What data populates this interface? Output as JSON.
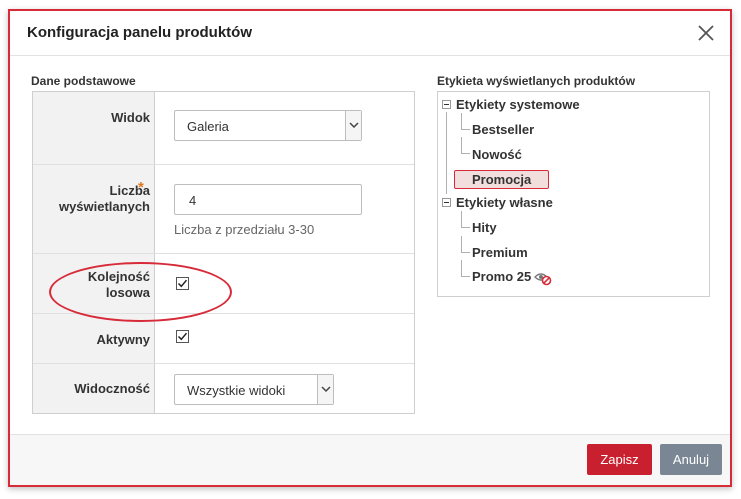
{
  "dialog": {
    "title": "Konfiguracja panelu produktów",
    "close_icon": "close-icon"
  },
  "basic": {
    "section_label": "Dane podstawowe",
    "view": {
      "label": "Widok",
      "value": "Galeria"
    },
    "count": {
      "label_line1": "Liczba",
      "label_line2": "wyświetlanych",
      "required_mark": "*",
      "value": "4",
      "hint": "Liczba z przedziału 3-30"
    },
    "random": {
      "label_line1": "Kolejność",
      "label_line2": "losowa",
      "checked": true
    },
    "active": {
      "label": "Aktywny",
      "checked": true
    },
    "visibility": {
      "label": "Widoczność",
      "value": "Wszystkie widoki"
    }
  },
  "labels_tree": {
    "section_label": "Etykieta wyświetlanych produktów",
    "groups": [
      {
        "name": "Etykiety systemowe",
        "items": [
          "Bestseller",
          "Nowość",
          "Promocja"
        ]
      },
      {
        "name": "Etykiety własne",
        "items": [
          "Hity",
          "Premium",
          "Promo 25"
        ]
      }
    ],
    "selected": "Promocja",
    "hidden_icon": "eye-hidden-icon"
  },
  "footer": {
    "save_label": "Zapisz",
    "cancel_label": "Anuluj"
  },
  "colors": {
    "accent": "#d72b3a",
    "save_bg": "#c8202f",
    "cancel_bg": "#7a8693",
    "required": "#e07820"
  }
}
